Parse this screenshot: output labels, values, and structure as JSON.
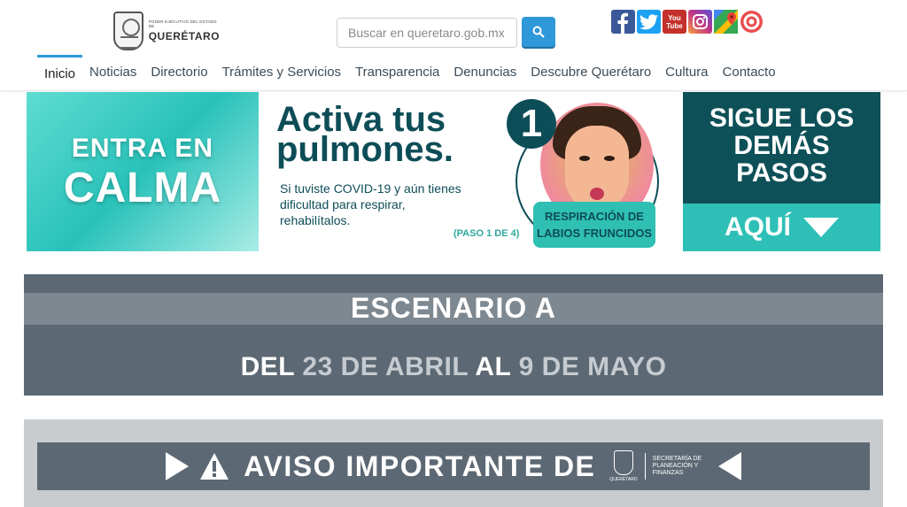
{
  "header": {
    "logo": {
      "small": "PODER EJECUTIVO DEL ESTADO DE",
      "big": "QUERÉTARO"
    },
    "search": {
      "placeholder": "Buscar en queretaro.gob.mx"
    },
    "social": [
      {
        "name": "facebook",
        "color": "#3b5998"
      },
      {
        "name": "twitter",
        "color": "#1da1f2"
      },
      {
        "name": "youtube",
        "color": "#c4302b",
        "label": "You Tube"
      },
      {
        "name": "instagram",
        "color": "#c13584"
      },
      {
        "name": "maps",
        "color": "#34a853"
      },
      {
        "name": "target",
        "color": "#e94e4e"
      }
    ]
  },
  "nav": {
    "items": [
      {
        "label": "Inicio"
      },
      {
        "label": "Noticias"
      },
      {
        "label": "Directorio"
      },
      {
        "label": "Trámites y Servicios"
      },
      {
        "label": "Transparencia"
      },
      {
        "label": "Denuncias"
      },
      {
        "label": "Descubre Querétaro"
      },
      {
        "label": "Cultura"
      },
      {
        "label": "Contacto"
      }
    ]
  },
  "banner": {
    "calma_line1": "ENTRA EN",
    "calma_line2": "CALMA",
    "title_line1": "Activa tus",
    "title_line2": "pulmones.",
    "body_line1": "Si tuviste COVID-19 y aún tienes",
    "body_line2": "dificultad para respirar,",
    "body_line3": "rehabilítalos.",
    "paso": "(PASO 1 DE 4)",
    "number": "1",
    "tag_line1": "RESPIRACIÓN DE",
    "tag_line2": "LABIOS FRUNCIDOS",
    "pasos_line1": "SIGUE LOS",
    "pasos_line2": "DEMÁS",
    "pasos_line3": "PASOS",
    "aqui": "AQUÍ"
  },
  "escenario": {
    "title": "ESCENARIO A",
    "del": "DEL",
    "start": "23 DE ABRIL",
    "al": "AL",
    "end": "9 DE MAYO"
  },
  "aviso": {
    "text": "AVISO IMPORTANTE DE",
    "logo_small": "QUERÉTARO",
    "secretaria": "SECRETARÍA DE PLANEACIÓN Y FINANZAS"
  }
}
